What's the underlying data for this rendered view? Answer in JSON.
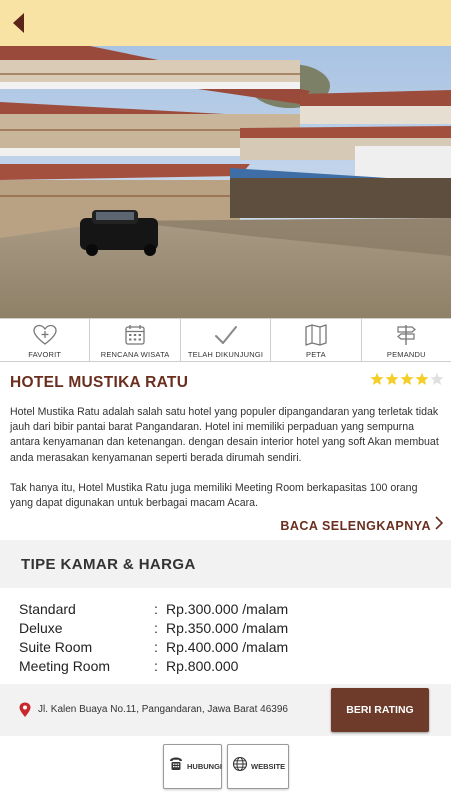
{
  "header": {
    "back_icon": "back-arrow-icon",
    "background": "#f8e3a4"
  },
  "hero": {
    "alt_icon": "hotel-photo"
  },
  "actions": [
    {
      "label": "FAVORIT",
      "icon": "heart-plus-icon"
    },
    {
      "label": "RENCANA WISATA",
      "icon": "calendar-icon"
    },
    {
      "label": "TELAH DIKUNJUNGI",
      "icon": "checkmark-icon"
    },
    {
      "label": "PETA",
      "icon": "map-icon"
    },
    {
      "label": "PEMANDU",
      "icon": "signpost-icon"
    }
  ],
  "hotel": {
    "name": "HOTEL MUSTIKA RATU",
    "rating": 4,
    "rating_max": 5,
    "description": [
      "Hotel Mustika Ratu adalah salah satu hotel yang populer dipangandaran yang terletak tidak jauh dari bibir pantai barat Pangandaran. Hotel ini memiliki perpaduan yang sempurna antara kenyamanan dan ketenangan. dengan desain interior hotel yang soft Akan membuat anda merasakan kenyamanan seperti berada dirumah sendiri.",
      "Tak hanya itu, Hotel Mustika Ratu juga memiliki Meeting Room berkapasitas 100 orang yang dapat digunakan untuk berbagai macam Acara."
    ],
    "read_more": "BACA SELENGKAPNYA"
  },
  "rooms": {
    "title": "TIPE KAMAR & HARGA",
    "items": [
      {
        "name": "Standard",
        "sep": ":",
        "price": "Rp.300.000 /malam"
      },
      {
        "name": "Deluxe",
        "sep": ":",
        "price": "Rp.350.000 /malam"
      },
      {
        "name": "Suite Room",
        "sep": ":",
        "price": "Rp.400.000 /malam"
      },
      {
        "name": "Meeting Room",
        "sep": ":",
        "price": "Rp.800.000"
      }
    ]
  },
  "location": {
    "address": "Jl. Kalen Buaya No.11, Pangandaran, Jawa Barat 46396",
    "pin_icon": "location-pin-icon",
    "rate_label": "BERI RATING"
  },
  "contact": {
    "call_label": "HUBUNGI",
    "call_icon": "telephone-icon",
    "web_label": "WEBSITE",
    "web_icon": "globe-icon"
  },
  "colors": {
    "brand": "#6b2e1e",
    "button": "#6e3a2a",
    "star": "#f5cf29",
    "pin": "#c9282d"
  }
}
